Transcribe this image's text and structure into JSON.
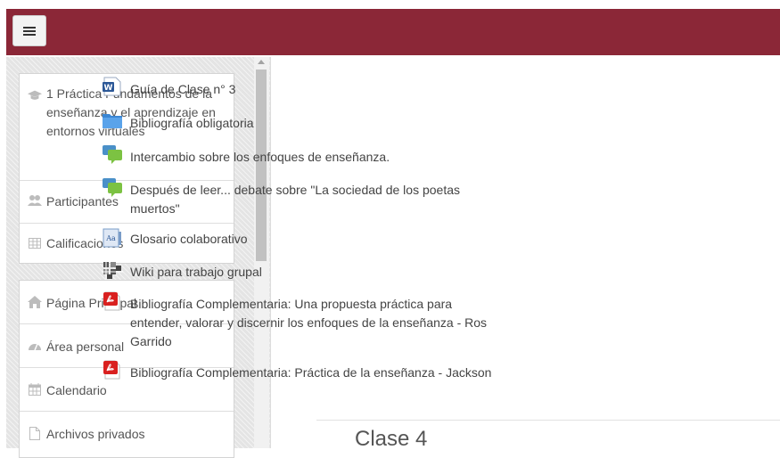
{
  "header": {
    "menu_button_label": "≡",
    "brand_color": "#8b2737"
  },
  "sidebar": {
    "course_block": [
      {
        "icon": "graduation-cap-icon",
        "label": "1 Práctica Fundamentos de la enseñanza y el aprendizaje en entornos virtuales"
      },
      {
        "icon": "users-icon",
        "label": "Participantes"
      },
      {
        "icon": "table-icon",
        "label": "Calificaciones"
      }
    ],
    "site_block": [
      {
        "icon": "home-icon",
        "label": "Página Principal"
      },
      {
        "icon": "dashboard-icon",
        "label": "Área personal"
      },
      {
        "icon": "calendar-icon",
        "label": "Calendario"
      },
      {
        "icon": "file-icon",
        "label": "Archivos privados"
      }
    ]
  },
  "content": {
    "activities": [
      {
        "icon": "word-document-icon",
        "label": "Guía de Clase n° 3"
      },
      {
        "icon": "folder-icon",
        "label": "Bibliografía obligatoria"
      },
      {
        "icon": "forum-icon",
        "label": "Intercambio sobre los enfoques de enseñanza."
      },
      {
        "icon": "forum-icon",
        "label": "Después de leer... debate sobre \"La sociedad de los poetas muertos\""
      },
      {
        "icon": "glossary-icon",
        "label": "Glosario colaborativo"
      },
      {
        "icon": "wiki-icon",
        "label": "Wiki para trabajo grupal"
      },
      {
        "icon": "pdf-icon",
        "label": "Bibliografía Complementaria: Una propuesta práctica para entender, valorar y discernir los enfoques de la enseñanza - Ros Garrido"
      },
      {
        "icon": "pdf-icon",
        "label": "Bibliografía Complementaria: Práctica de la enseñanza - Jackson"
      }
    ],
    "next_section_title": "Clase 4"
  }
}
